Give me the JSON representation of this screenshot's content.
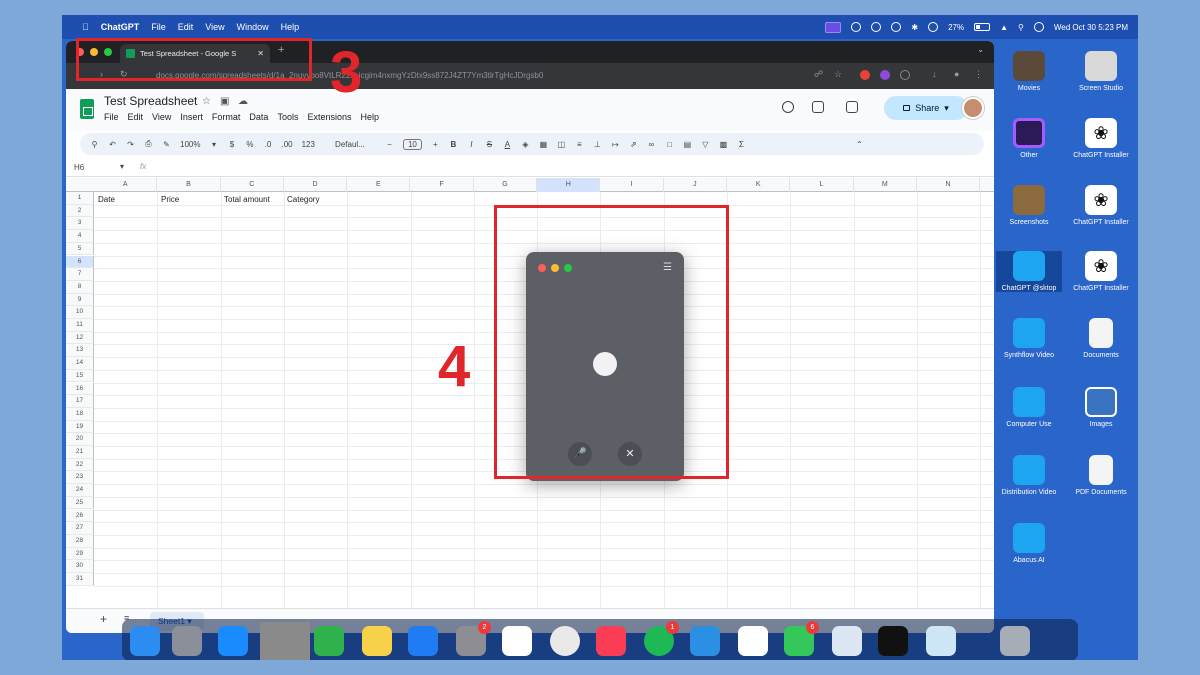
{
  "menubar": {
    "app": "ChatGPT",
    "items": [
      "File",
      "Edit",
      "View",
      "Window",
      "Help"
    ],
    "battery": "27%",
    "datetime": "Wed Oct 30  5:23 PM"
  },
  "browser": {
    "tab_title": "Test Spreadsheet - Google S",
    "url": "docs.google.com/spreadsheets/d/1a_2nuyybo8VtLR22saicgim4nxmgYzDtx9ss872J4ZT7Ym3tlrTgHcJDrgsb0"
  },
  "sheets": {
    "doc_title": "Test Spreadsheet",
    "menus": [
      "File",
      "Edit",
      "View",
      "Insert",
      "Format",
      "Data",
      "Tools",
      "Extensions",
      "Help"
    ],
    "share_label": "Share",
    "toolbar": {
      "zoom": "100%",
      "currency": "$",
      "percent": "%",
      "decimal_dec": ".0",
      "decimal_inc": ".00",
      "number_format": "123",
      "font": "Defaul...",
      "font_size": "10"
    },
    "name_box": "H6",
    "fx": "fx",
    "columns": [
      "A",
      "B",
      "C",
      "D",
      "E",
      "F",
      "G",
      "H",
      "I",
      "J",
      "K",
      "L",
      "M",
      "N"
    ],
    "selected_column": "H",
    "rows": [
      "1",
      "2",
      "3",
      "4",
      "5",
      "6",
      "7",
      "8",
      "9",
      "10",
      "11",
      "12",
      "13",
      "14",
      "15",
      "16",
      "17",
      "18",
      "19",
      "20",
      "21",
      "22",
      "23",
      "24",
      "25",
      "26",
      "27",
      "28",
      "29",
      "30",
      "31"
    ],
    "selected_row": "6",
    "headers": {
      "a1": "Date",
      "b1": "Price",
      "c1": "Total amount",
      "d1": "Category"
    },
    "sheet_tab": "Sheet1"
  },
  "annotations": {
    "label_3": "3",
    "label_4": "4"
  },
  "desktop": [
    {
      "label": "Movies"
    },
    {
      "label": "Screen Studio"
    },
    {
      "label": "Other"
    },
    {
      "label": "ChatGPT Installer"
    },
    {
      "label": "Screenshots"
    },
    {
      "label": "ChatGPT Installer"
    },
    {
      "label": "ChatGPT @sktop"
    },
    {
      "label": "ChatGPT Installer"
    },
    {
      "label": "Synthflow Video"
    },
    {
      "label": "Documents"
    },
    {
      "label": "Computer Use"
    },
    {
      "label": "Images"
    },
    {
      "label": "Distribution Video"
    },
    {
      "label": "PDF Documents"
    },
    {
      "label": "Abacus AI"
    }
  ],
  "dock": {
    "system_prefs_badge": "2",
    "spotify_badge": "1",
    "messages_badge": "6"
  },
  "colors": {
    "annotation_red": "#e0262a",
    "share_bg": "#c2e7ff",
    "sheets_green": "#0f9d58",
    "desktop_blue": "#2a66c9"
  }
}
